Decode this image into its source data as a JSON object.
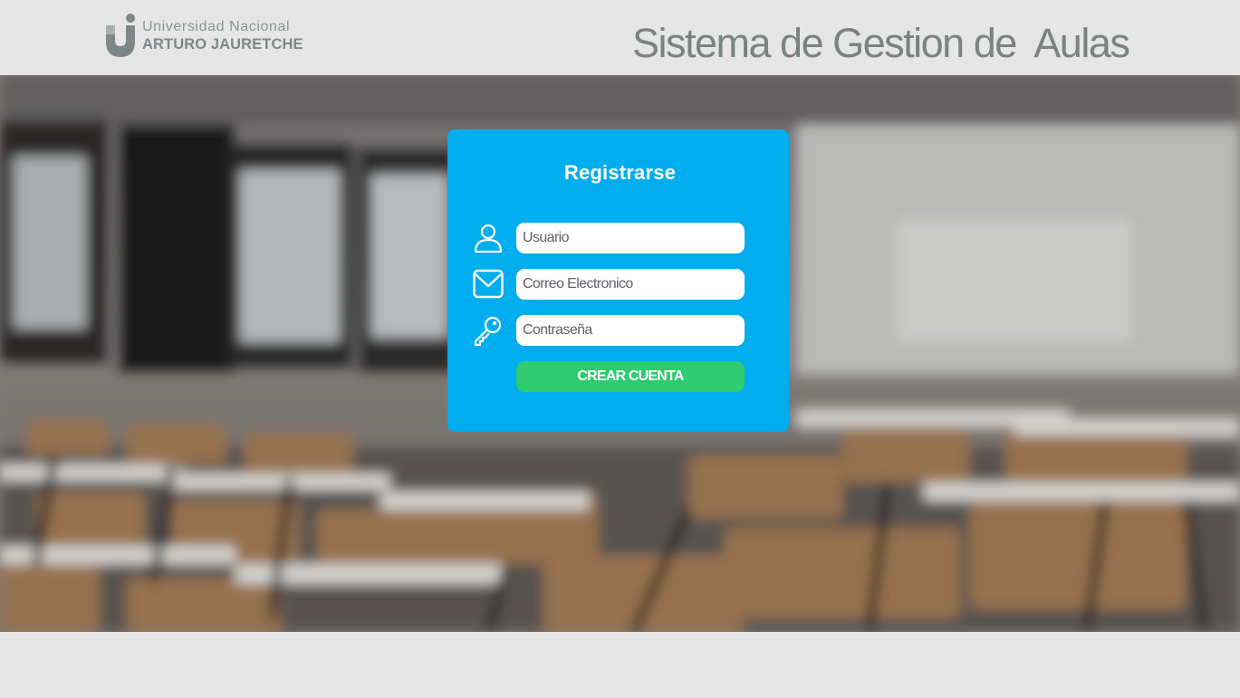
{
  "header": {
    "logo": {
      "line1": "Universidad Nacional",
      "line2": "ARTURO JAURETCHE"
    },
    "title": "Sistema de Gestion de  Aulas"
  },
  "register": {
    "title": "Registrarse",
    "fields": [
      {
        "icon": "user-icon",
        "placeholder": "Usuario",
        "value": ""
      },
      {
        "icon": "mail-icon",
        "placeholder": "Correo Electronico",
        "value": ""
      },
      {
        "icon": "key-icon",
        "placeholder": "Contraseña",
        "value": ""
      }
    ],
    "submit_label": "CREAR CUENTA"
  },
  "colors": {
    "card": "#00adee",
    "button": "#2ecc71",
    "header_bg": "#e6e6e6",
    "title_text": "#7a8282"
  }
}
